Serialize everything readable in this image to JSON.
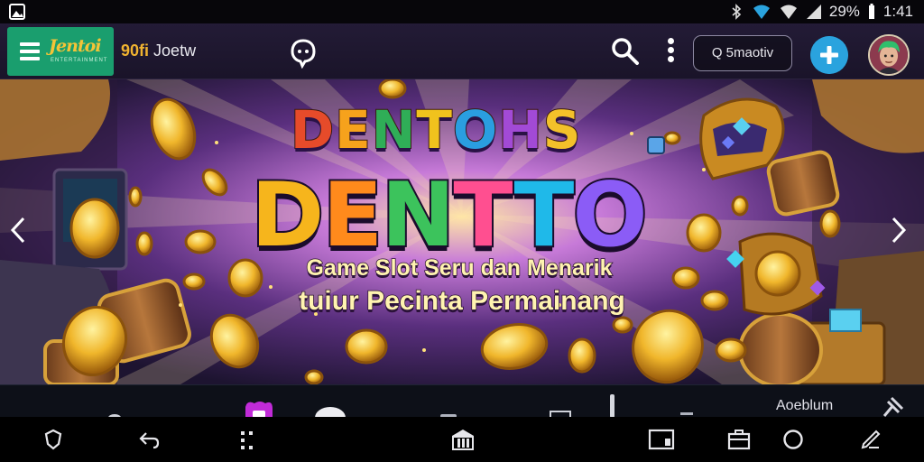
{
  "status_bar": {
    "battery": "29%",
    "time": "1:41"
  },
  "app_header": {
    "logo_text": "Jentoi",
    "logo_subtext": "ENTERTAINMENT",
    "brand_number": "90fi",
    "brand_name": "Joetw",
    "search_pill_label": "Q 5maotiv",
    "icons": [
      "menu-icon",
      "chat-icon",
      "search-icon",
      "more-icon",
      "plus-icon"
    ]
  },
  "banner": {
    "title_line_1": "DENTOHS",
    "title_line_2": "DENTTO",
    "tagline_1": "Game Slot Seru dan Menarik",
    "tagline_2": "tuiur Pecinta Permainang",
    "colors": {
      "title_1": [
        "#e64b2a",
        "#f6a21c",
        "#2fae57",
        "#f0c21d",
        "#2a9ee0",
        "#a24ad6",
        "#f3c12a"
      ],
      "title_2": [
        "#f6b51c",
        "#ff8a1c",
        "#3cc35c",
        "#ff4f90",
        "#1fb9e9",
        "#8b5cf6"
      ]
    }
  },
  "tab_strip": {
    "label": "Aoeblum"
  },
  "nav_bar": {
    "icons": [
      "shield-icon",
      "back-icon",
      "apps-icon",
      "store-icon",
      "window-icon",
      "briefcase-icon",
      "circle-icon",
      "edit-icon"
    ]
  },
  "accent_color": "#2aa3de",
  "brand_color": "#1a9e6e"
}
